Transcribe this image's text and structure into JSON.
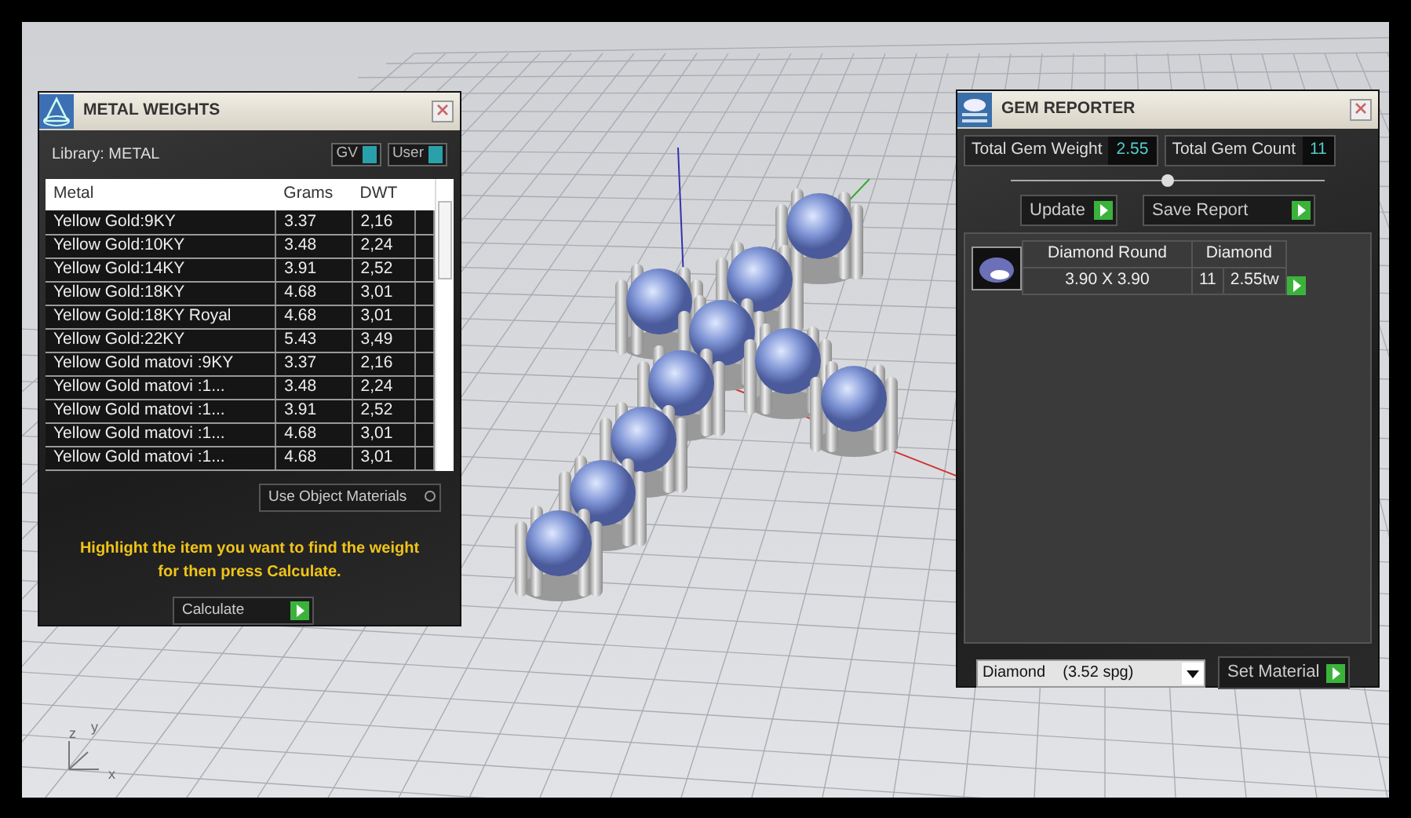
{
  "metal_weights": {
    "title": "METAL WEIGHTS",
    "library_label": "Library: METAL",
    "toggles": [
      {
        "label": "GV",
        "on": true
      },
      {
        "label": "User",
        "on": true
      }
    ],
    "table": {
      "columns": [
        "Metal",
        "Grams",
        "DWT"
      ],
      "rows": [
        [
          "Yellow Gold:9KY",
          "3.37",
          "2,16"
        ],
        [
          "Yellow Gold:10KY",
          "3.48",
          "2,24"
        ],
        [
          "Yellow Gold:14KY",
          "3.91",
          "2,52"
        ],
        [
          "Yellow Gold:18KY",
          "4.68",
          "3,01"
        ],
        [
          "Yellow Gold:18KY Royal",
          "4.68",
          "3,01"
        ],
        [
          "Yellow Gold:22KY",
          "5.43",
          "3,49"
        ],
        [
          "Yellow Gold matovi :9KY",
          "3.37",
          "2,16"
        ],
        [
          "Yellow Gold matovi :1...",
          "3.48",
          "2,24"
        ],
        [
          "Yellow Gold matovi :1...",
          "3.91",
          "2,52"
        ],
        [
          "Yellow Gold matovi :1...",
          "4.68",
          "3,01"
        ],
        [
          "Yellow Gold matovi :1...",
          "4.68",
          "3,01"
        ]
      ]
    },
    "use_object_materials": "Use Object Materials",
    "hint": "Highlight the item you want to find the weight for then press Calculate.",
    "calculate_button": "Calculate"
  },
  "gem_reporter": {
    "title": "GEM REPORTER",
    "total_gem_weight_label": "Total Gem Weight",
    "total_gem_weight": "2.55",
    "total_gem_count_label": "Total Gem Count",
    "total_gem_count": "11",
    "buttons": [
      "Update",
      "Save Report"
    ],
    "gems": [
      {
        "shape": "Diamond Round",
        "material": "Diamond",
        "size": "3.90 X 3.90",
        "count": "11",
        "weight": "2.55tw"
      }
    ],
    "material_select": "Diamond    (3.52 spg)",
    "set_material_button": "Set Material"
  },
  "axis_labels": [
    "z",
    "y",
    "x"
  ]
}
